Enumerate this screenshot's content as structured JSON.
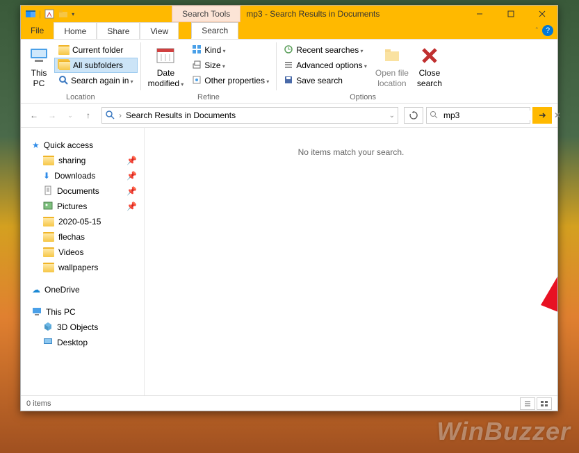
{
  "window": {
    "title": "mp3 - Search Results in Documents",
    "search_tools_label": "Search Tools"
  },
  "tabs": {
    "file": "File",
    "home": "Home",
    "share": "Share",
    "view": "View",
    "search": "Search"
  },
  "ribbon": {
    "this_pc": "This\nPC",
    "current_folder": "Current folder",
    "all_subfolders": "All subfolders",
    "search_again_in": "Search again in",
    "group_location": "Location",
    "date_modified": "Date\nmodified",
    "kind": "Kind",
    "size": "Size",
    "other_properties": "Other properties",
    "group_refine": "Refine",
    "recent_searches": "Recent searches",
    "advanced_options": "Advanced options",
    "save_search": "Save search",
    "open_file_location": "Open file\nlocation",
    "close_search": "Close\nsearch",
    "group_options": "Options"
  },
  "address": {
    "path_text": "Search Results in Documents"
  },
  "search": {
    "value": "mp3"
  },
  "tree": {
    "quick_access": "Quick access",
    "sharing": "sharing",
    "downloads": "Downloads",
    "documents": "Documents",
    "pictures": "Pictures",
    "d2020": "2020-05-15",
    "flechas": "flechas",
    "videos": "Videos",
    "wallpapers": "wallpapers",
    "onedrive": "OneDrive",
    "this_pc": "This PC",
    "objects3d": "3D Objects",
    "desktop": "Desktop"
  },
  "main": {
    "empty": "No items match your search."
  },
  "status": {
    "items": "0 items"
  },
  "watermark": "WinBuzzer"
}
